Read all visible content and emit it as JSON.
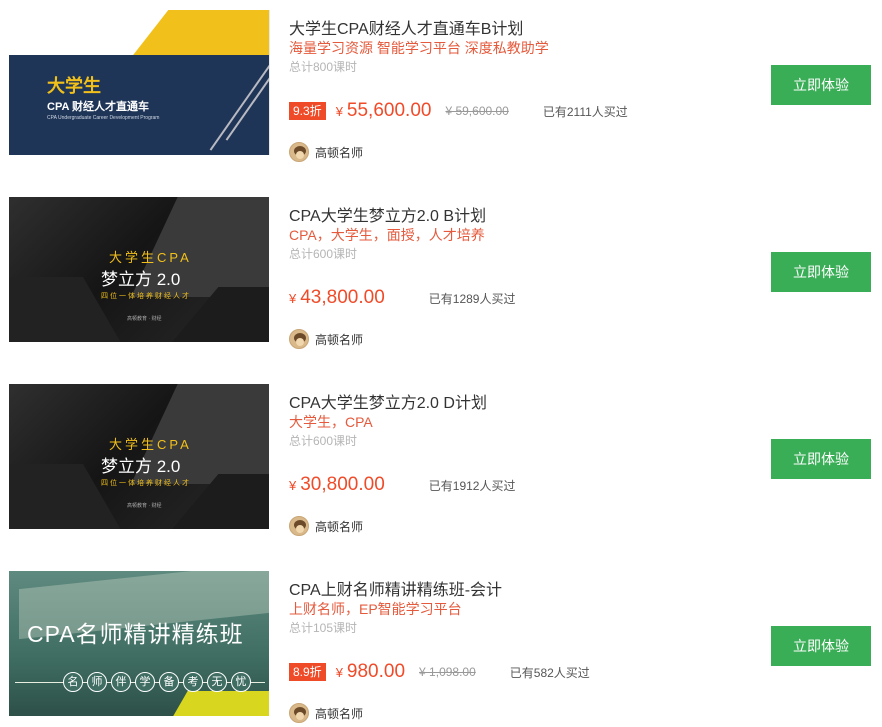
{
  "courses": [
    {
      "title": "大学生CPA财经人才直通车B计划",
      "tags": "海量学习资源 智能学习平台 深度私教助学",
      "hours": "总计800课时",
      "discount": "9.3折",
      "currency": "¥",
      "price": "55,600.00",
      "original_price": "¥ 59,600.00",
      "sold": "已有2111人买过",
      "teacher": "高顿名师",
      "button": "立即体验",
      "thumb": {
        "big": "大学生",
        "sub": "CPA 财经人才直通车",
        "en": "CPA Undergraduate Career Development Program"
      }
    },
    {
      "title": "CPA大学生梦立方2.0 B计划",
      "tags": "CPA，大学生，面授，人才培养",
      "hours": "总计600课时",
      "currency": "¥",
      "price": "43,800.00",
      "sold": "已有1289人买过",
      "teacher": "高顿名师",
      "button": "立即体验",
      "thumb": {
        "line1": "大学生CPA",
        "line2": "梦立方 2.0",
        "line3": "四位一体培养财经人才",
        "logo": "高顿教育 · 财经"
      }
    },
    {
      "title": "CPA大学生梦立方2.0 D计划",
      "tags": "大学生，CPA",
      "hours": "总计600课时",
      "currency": "¥",
      "price": "30,800.00",
      "sold": "已有1912人买过",
      "teacher": "高顿名师",
      "button": "立即体验",
      "thumb": {
        "line1": "大学生CPA",
        "line2": "梦立方 2.0",
        "line3": "四位一体培养财经人才",
        "logo": "高顿教育 · 财经"
      }
    },
    {
      "title": "CPA上财名师精讲精练班-会计",
      "tags": "上财名师，EP智能学习平台",
      "hours": "总计105课时",
      "discount": "8.9折",
      "currency": "¥",
      "price": "980.00",
      "original_price": "¥ 1,098.00",
      "sold": "已有582人买过",
      "teacher": "高顿名师",
      "button": "立即体验",
      "thumb": {
        "heading": "CPA名师精讲精练班",
        "chips": [
          "名",
          "师",
          "伴",
          "学",
          "备",
          "考",
          "无",
          "忧"
        ]
      }
    }
  ],
  "colors": {
    "accent": "#f04b29",
    "button": "#3aae57",
    "tags": "#e55a3c"
  }
}
